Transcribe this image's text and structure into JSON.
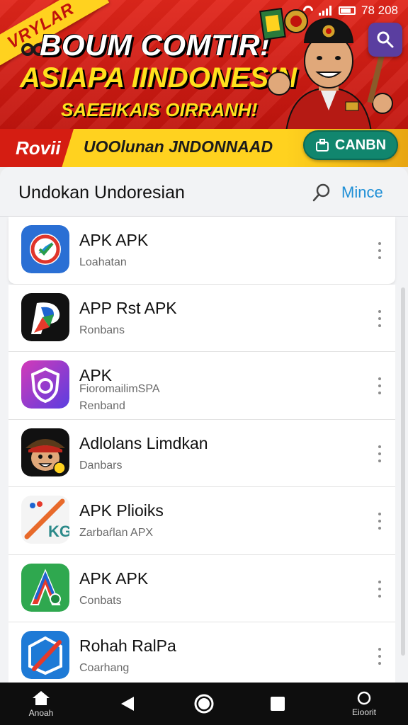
{
  "status_bar": {
    "time": "78 208"
  },
  "banner": {
    "ribbon": "VRYLAR",
    "headline": "BOUM COMTIR!",
    "subheadline": "ASIAPA IINDONESIN",
    "tagline": "SAEEIKAIS OIRRANH!",
    "badge": "Rovii",
    "caption": "UOOlunan JNDONNAAD",
    "cta_label": "CANBN",
    "colors": {
      "red": "#d51d12",
      "yellow": "#ffd21f",
      "green": "#11866e"
    }
  },
  "panel": {
    "title": "Undokan Undoresian",
    "more_label": "Mince"
  },
  "apps": [
    {
      "name": "APK APK",
      "sub": "Loahatan",
      "icon": "compass-app-icon"
    },
    {
      "name": "APP Rst APK",
      "sub": "Ronbans",
      "icon": "p-logo-app-icon"
    },
    {
      "name": "APK",
      "sub": "FioromailimSPA",
      "sub2": "Renband",
      "icon": "shield-app-icon"
    },
    {
      "name": "Adlolans Limdkan",
      "sub": "Danbars",
      "icon": "character-app-icon"
    },
    {
      "name": "APK Plioiks",
      "sub": "Zarbaŕlan APX",
      "icon": "kg-app-icon"
    },
    {
      "name": "APK APK",
      "sub": "Conbats",
      "icon": "a-logo-app-icon"
    },
    {
      "name": "Rohah RalPa",
      "sub": "Coarhang",
      "icon": "blue-x-app-icon"
    }
  ],
  "navbar": {
    "home_label": "Anoah",
    "recent_label": "Eioorit"
  }
}
